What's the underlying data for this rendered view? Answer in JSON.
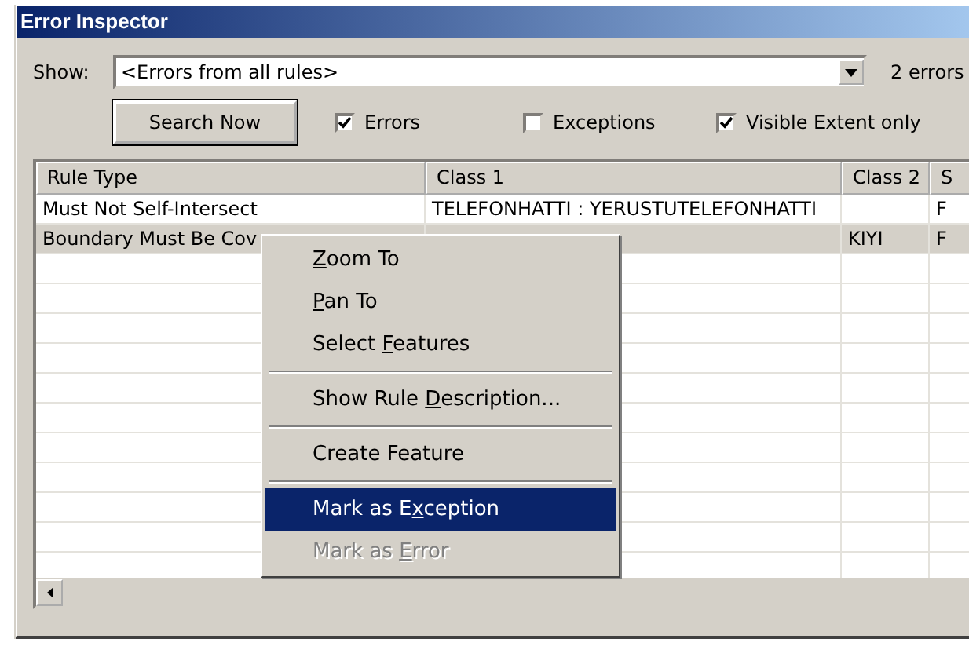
{
  "window": {
    "title": "Error Inspector"
  },
  "show": {
    "label": "Show:",
    "value": "<Errors from all rules>",
    "count": "2 errors"
  },
  "search_button": "Search Now",
  "filters": [
    {
      "label": "Errors",
      "checked": true
    },
    {
      "label": "Exceptions",
      "checked": false
    },
    {
      "label": "Visible Extent only",
      "checked": true
    }
  ],
  "table": {
    "columns": [
      "Rule Type",
      "Class 1",
      "Class 2",
      "S"
    ],
    "rows": [
      {
        "cells": [
          "Must Not Self-Intersect",
          "TELEFONHATTI : YERUSTUTELEFONHATTI",
          "",
          "F"
        ],
        "selected": false
      },
      {
        "cells": [
          "Boundary Must Be Cov",
          "",
          "KIYI",
          "F"
        ],
        "selected": true
      }
    ]
  },
  "context_menu": [
    {
      "kind": "item",
      "key": "Z",
      "post": "oom To",
      "selected": false,
      "disabled": false
    },
    {
      "kind": "item",
      "key": "P",
      "post": "an To",
      "selected": false,
      "disabled": false
    },
    {
      "kind": "item",
      "pre": "Select ",
      "key": "F",
      "post": "eatures",
      "selected": false,
      "disabled": false
    },
    {
      "kind": "separator"
    },
    {
      "kind": "item",
      "pre": "Show Rule ",
      "key": "D",
      "post": "escription...",
      "selected": false,
      "disabled": false
    },
    {
      "kind": "separator"
    },
    {
      "kind": "item",
      "pre": "Create Feature",
      "selected": false,
      "disabled": false
    },
    {
      "kind": "separator"
    },
    {
      "kind": "item",
      "pre": "Mark as E",
      "key": "x",
      "post": "ception",
      "selected": true,
      "disabled": false
    },
    {
      "kind": "item",
      "pre": "Mark as ",
      "key": "E",
      "post": "rror",
      "selected": false,
      "disabled": true
    }
  ]
}
